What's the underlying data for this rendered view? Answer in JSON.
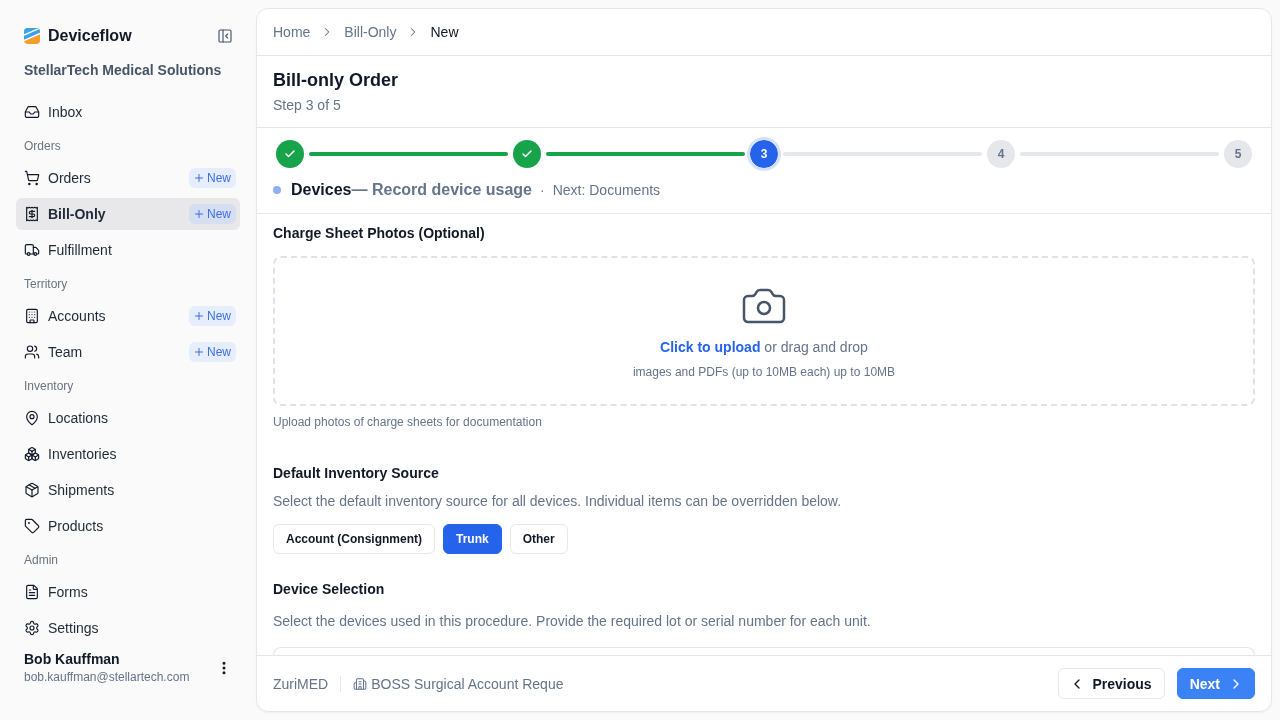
{
  "sidebar": {
    "brand": "Deviceflow",
    "organization": "StellarTech Medical Solutions",
    "nav": [
      {
        "kind": "item",
        "label": "Inbox",
        "selected": false
      },
      {
        "kind": "section",
        "label": "Orders"
      },
      {
        "kind": "item",
        "label": "Orders",
        "selected": false,
        "badge": "New"
      },
      {
        "kind": "item",
        "label": "Bill-Only",
        "selected": true,
        "badge": "New"
      },
      {
        "kind": "item",
        "label": "Fulfillment",
        "selected": false
      },
      {
        "kind": "section",
        "label": "Territory"
      },
      {
        "kind": "item",
        "label": "Accounts",
        "selected": false,
        "badge": "New"
      },
      {
        "kind": "item",
        "label": "Team",
        "selected": false,
        "badge": "New"
      },
      {
        "kind": "section",
        "label": "Inventory"
      },
      {
        "kind": "item",
        "label": "Locations",
        "selected": false
      },
      {
        "kind": "item",
        "label": "Inventories",
        "selected": false
      },
      {
        "kind": "item",
        "label": "Shipments",
        "selected": false
      },
      {
        "kind": "item",
        "label": "Products",
        "selected": false
      },
      {
        "kind": "section",
        "label": "Admin"
      },
      {
        "kind": "item",
        "label": "Forms",
        "selected": false
      },
      {
        "kind": "item",
        "label": "Settings",
        "selected": false
      }
    ],
    "user": {
      "name": "Bob Kauffman",
      "email": "bob.kauffman@stellartech.com"
    }
  },
  "breadcrumb": [
    {
      "label": "Home",
      "current": false
    },
    {
      "label": "Bill-Only",
      "current": false
    },
    {
      "label": "New",
      "current": true
    }
  ],
  "header": {
    "title": "Bill-only Order",
    "subtitle": "Step 3 of 5"
  },
  "stepper": {
    "steps": [
      {
        "completed": true,
        "selected": false
      },
      {
        "completed": true,
        "selected": false
      },
      {
        "completed": false,
        "selected": true,
        "number": "3"
      },
      {
        "completed": false,
        "selected": false,
        "number": "4"
      },
      {
        "completed": false,
        "selected": false,
        "number": "5"
      }
    ],
    "current_title": "Devices",
    "current_description": "— Record device usage",
    "separator": "·",
    "next": "Next: Documents"
  },
  "charge_sheet": {
    "label": "Charge Sheet Photos (Optional)",
    "upload_link": "Click to upload",
    "upload_text": "or drag and drop",
    "upload_hint": "images and PDFs (up to 10MB each) up to 10MB",
    "help": "Upload photos of charge sheets for documentation"
  },
  "inventory_source": {
    "label": "Default Inventory Source",
    "description": "Select the default inventory source for all devices. Individual items can be overridden below.",
    "options": [
      {
        "label": "Account (Consignment)",
        "selected": false
      },
      {
        "label": "Trunk",
        "selected": true
      },
      {
        "label": "Other",
        "selected": false
      }
    ]
  },
  "device_selection": {
    "label": "Device Selection",
    "description": "Select the devices used in this procedure. Provide the required lot or serial number for each unit."
  },
  "footer": {
    "account": "ZuriMED",
    "procedure": "BOSS Surgical Account Reque",
    "previous": "Previous",
    "next": "Next"
  }
}
